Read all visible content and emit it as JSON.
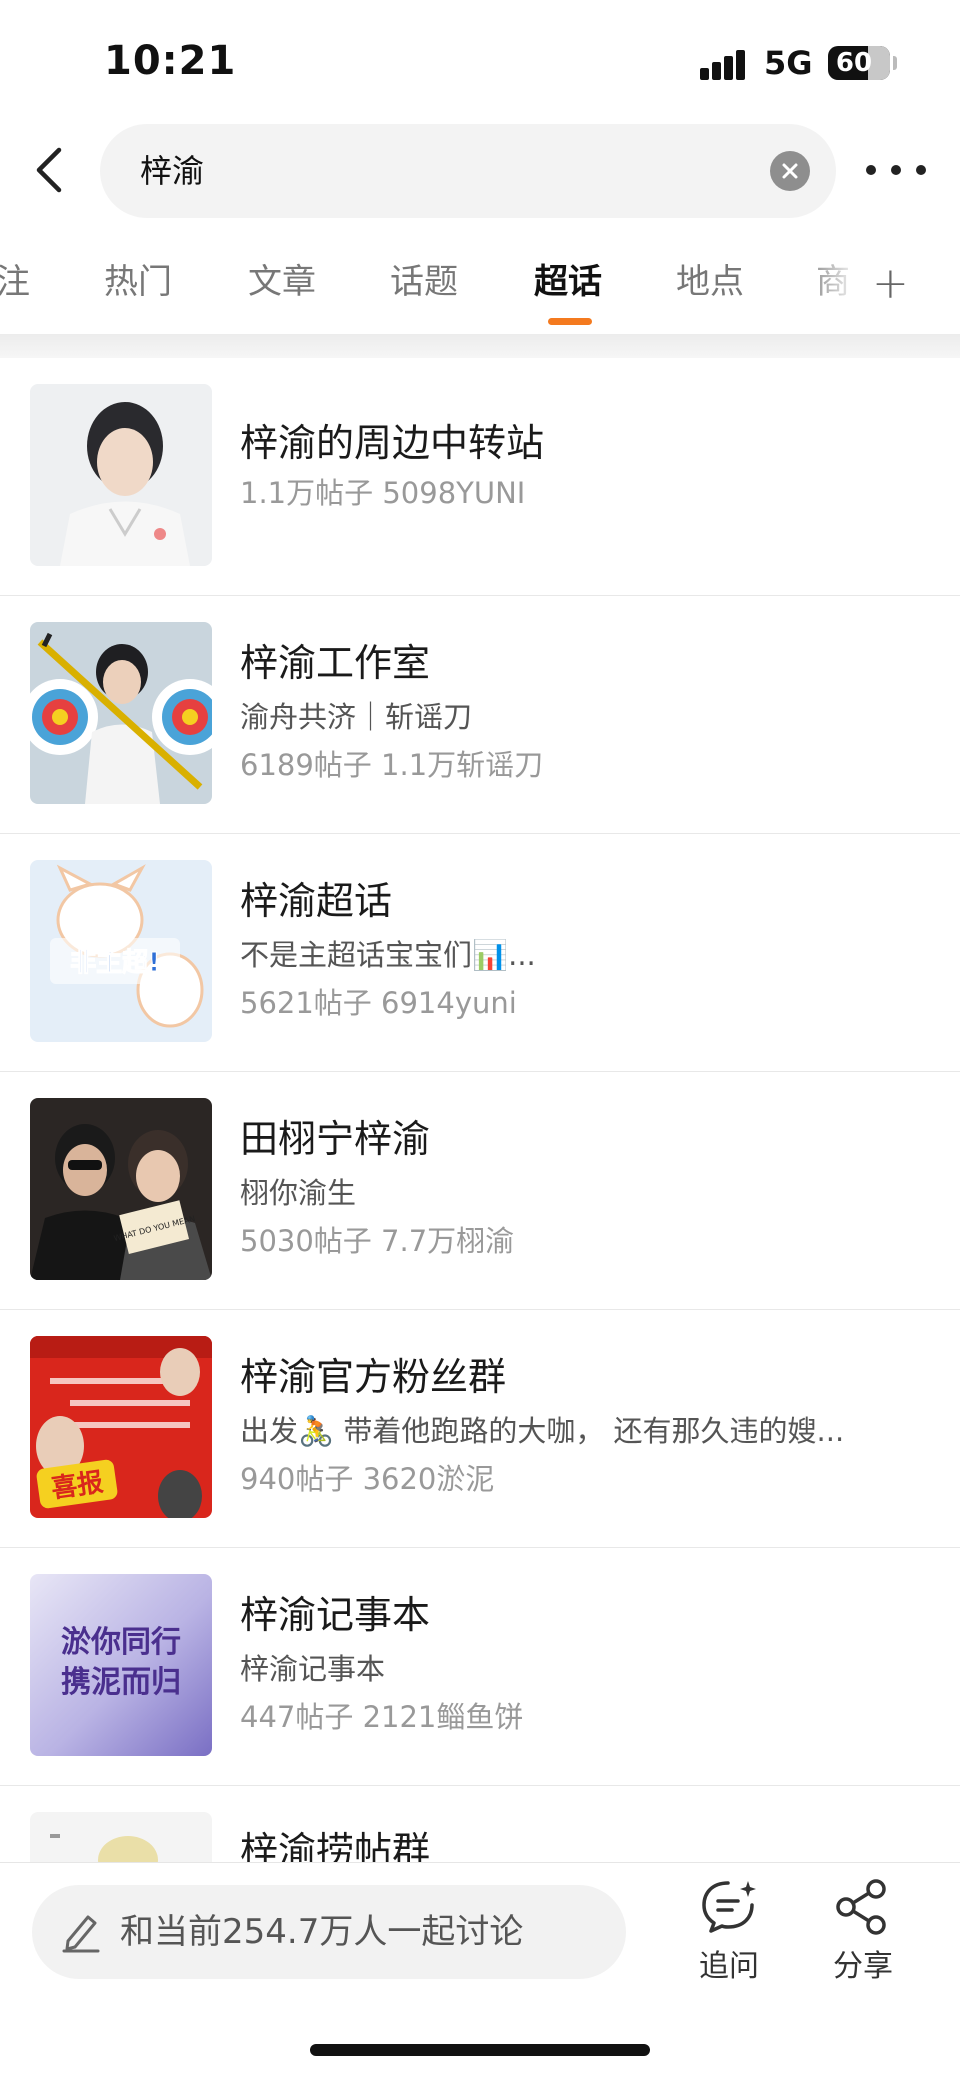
{
  "status_bar": {
    "time": "10:21",
    "network": "5G",
    "battery": "60"
  },
  "search": {
    "query": "梓渝",
    "back_icon": "chevron-left-icon",
    "clear_icon": "clear-circle-icon",
    "more_icon": "more-horizontal-icon"
  },
  "tabs": [
    {
      "label": "注"
    },
    {
      "label": "热门"
    },
    {
      "label": "文章"
    },
    {
      "label": "话题"
    },
    {
      "label": "超话",
      "active": true
    },
    {
      "label": "地点"
    },
    {
      "label": "商"
    }
  ],
  "tabs_add_label": "+",
  "accent_color": "#f47a1f",
  "results": [
    {
      "title": "梓渝的周边中转站",
      "subtitle": "",
      "meta": "1.1万帖子 5098YUNI"
    },
    {
      "title": "梓渝工作室",
      "subtitle": "渝舟共济｜斩谣刀",
      "meta": "6189帖子 1.1万斩谣刀"
    },
    {
      "title": "梓渝超话",
      "subtitle": "不是主超话宝宝们📊...",
      "meta": "5621帖子 6914yuni",
      "thumb_text": "非主超!"
    },
    {
      "title": "田栩宁梓渝",
      "subtitle": "栩你渝生",
      "meta": "5030帖子 7.7万栩渝",
      "thumb_text": "WHAT DO YOU MEAN"
    },
    {
      "title": "梓渝官方粉丝群",
      "subtitle": "出发🚴 带着他跑路的大咖， 还有那久违的嫂...",
      "meta": "940帖子 3620淤泥",
      "thumb_text": "喜报"
    },
    {
      "title": "梓渝记事本",
      "subtitle": "梓渝记事本",
      "meta": "447帖子 2121鲻鱼饼",
      "thumb_text_1": "淤你同行",
      "thumb_text_2": "携泥而归"
    },
    {
      "title": "梓渝捞帖群",
      "subtitle": "",
      "meta": ""
    }
  ],
  "bottom": {
    "discuss_placeholder": "和当前254.7万人一起讨论",
    "ask_label": "追问",
    "share_label": "分享"
  }
}
